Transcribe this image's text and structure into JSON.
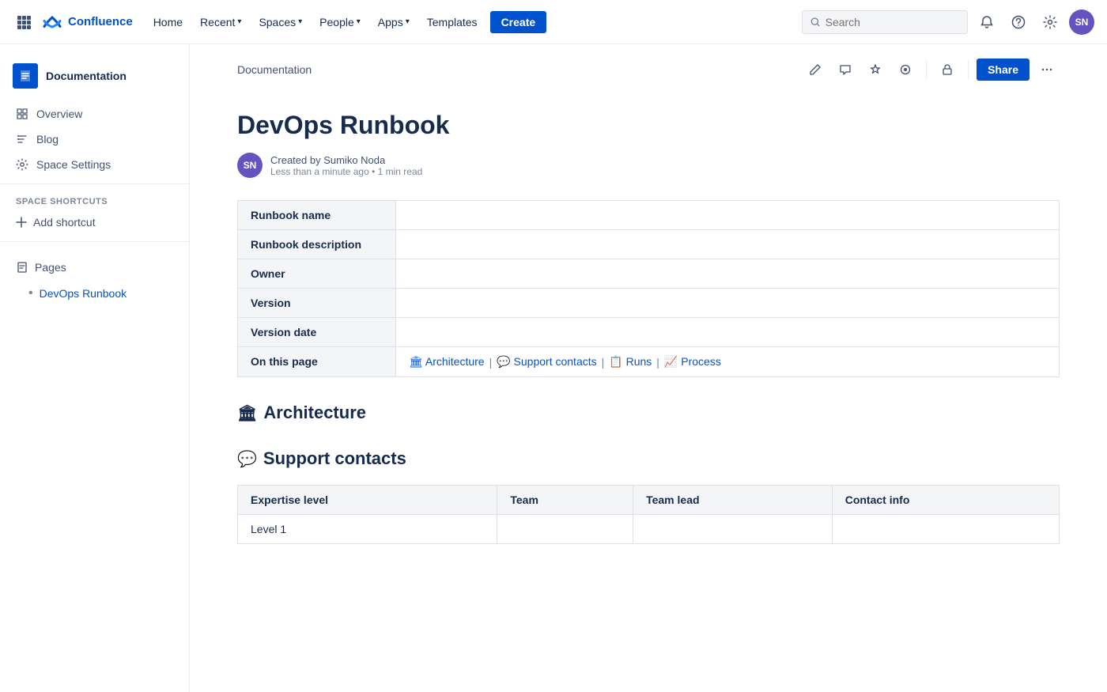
{
  "topnav": {
    "logo_text": "Confluence",
    "home": "Home",
    "recent": "Recent",
    "spaces": "Spaces",
    "people": "People",
    "apps": "Apps",
    "templates": "Templates",
    "create": "Create",
    "search_placeholder": "Search",
    "user_initials": "SN"
  },
  "sidebar": {
    "space_name": "Documentation",
    "space_initial": "D",
    "overview": "Overview",
    "blog": "Blog",
    "space_settings": "Space Settings",
    "shortcuts_label": "SPACE SHORTCUTS",
    "add_shortcut": "Add shortcut",
    "pages_label": "Pages",
    "page_child": "DevOps Runbook"
  },
  "breadcrumb": "Documentation",
  "toolbar": {
    "share": "Share"
  },
  "page": {
    "title": "DevOps Runbook",
    "author_initials": "SN",
    "created_by": "Created by Sumiko Noda",
    "time_info": "Less than a minute ago • 1 min read"
  },
  "info_table": {
    "rows": [
      {
        "label": "Runbook name",
        "value": ""
      },
      {
        "label": "Runbook description",
        "value": ""
      },
      {
        "label": "Owner",
        "value": ""
      },
      {
        "label": "Version",
        "value": ""
      },
      {
        "label": "Version date",
        "value": ""
      },
      {
        "label": "On this page",
        "links": [
          {
            "icon": "🏛",
            "text": "Architecture"
          },
          {
            "icon": "💬",
            "text": "Support contacts"
          },
          {
            "icon": "📋",
            "text": "Runs"
          },
          {
            "icon": "📈",
            "text": "Process"
          }
        ]
      }
    ]
  },
  "sections": {
    "architecture": {
      "icon": "🏛",
      "title": "Architecture"
    },
    "support_contacts": {
      "icon": "💬",
      "title": "Support contacts",
      "table_headers": [
        "Expertise level",
        "Team",
        "Team lead",
        "Contact info"
      ],
      "rows": [
        {
          "expertise": "Level 1",
          "team": "",
          "team_lead": "",
          "contact_info": ""
        }
      ]
    }
  }
}
